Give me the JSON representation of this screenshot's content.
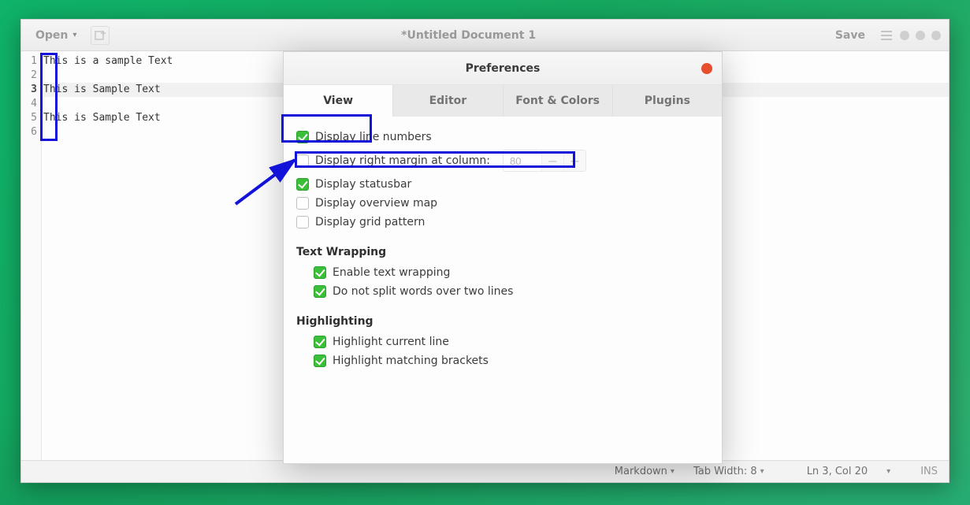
{
  "header": {
    "open_label": "Open",
    "title": "*Untitled Document 1",
    "save_label": "Save"
  },
  "editor": {
    "lines": [
      {
        "n": "1",
        "text": "This is a sample Text",
        "current": false
      },
      {
        "n": "2",
        "text": "",
        "current": false
      },
      {
        "n": "3",
        "text": "This is Sample Text",
        "current": true
      },
      {
        "n": "4",
        "text": "",
        "current": false
      },
      {
        "n": "5",
        "text": "This is Sample Text",
        "current": false
      },
      {
        "n": "6",
        "text": "",
        "current": false
      }
    ]
  },
  "statusbar": {
    "syntax": "Markdown",
    "tab_width": "Tab Width: 8",
    "position": "Ln 3, Col 20",
    "ins": "INS"
  },
  "prefs": {
    "title": "Preferences",
    "tabs": {
      "view": "View",
      "editor": "Editor",
      "font": "Font & Colors",
      "plugins": "Plugins"
    },
    "view": {
      "display_line_numbers": "Display line numbers",
      "display_right_margin": "Display right margin at column:",
      "right_margin_value": "80",
      "display_statusbar": "Display statusbar",
      "display_overview_map": "Display overview map",
      "display_grid_pattern": "Display grid pattern",
      "section_wrapping": "Text Wrapping",
      "enable_text_wrapping": "Enable text wrapping",
      "no_split_words": "Do not split words over two lines",
      "section_highlighting": "Highlighting",
      "highlight_current_line": "Highlight current line",
      "highlight_matching_brackets": "Highlight matching brackets"
    }
  }
}
